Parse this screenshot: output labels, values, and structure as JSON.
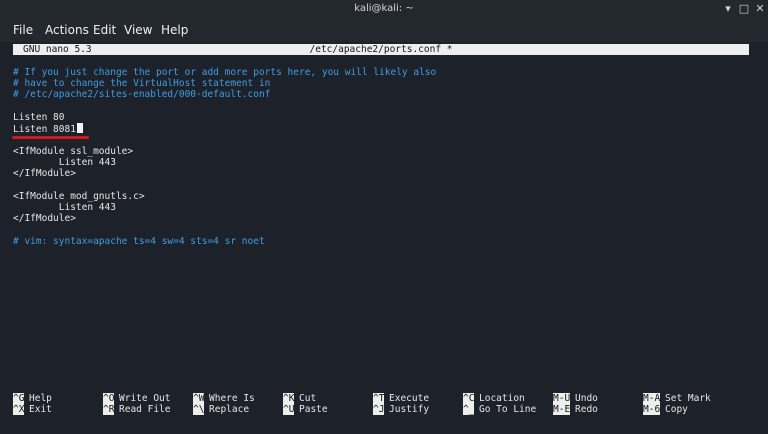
{
  "window": {
    "title": "kali@kali: ~"
  },
  "menu": {
    "file": "File",
    "actions": "Actions",
    "edit": "Edit",
    "view": "View",
    "help": "Help"
  },
  "nano": {
    "version": "GNU nano 5.3",
    "filename": "/etc/apache2/ports.conf *"
  },
  "lines": [
    "# If you just change the port or add more ports here, you will likely also",
    "# have to change the VirtualHost statement in",
    "# /etc/apache2/sites-enabled/000-default.conf",
    "Listen 80",
    "Listen 8081",
    "<IfModule ssl_module>",
    "        Listen 443",
    "</IfModule>",
    "<IfModule mod_gnutls.c>",
    "        Listen 443",
    "</IfModule>",
    "# vim: syntax=apache ts=4 sw=4 sts=4 sr noet"
  ],
  "shortcuts": [
    {
      "key": "^G",
      "label": "Help"
    },
    {
      "key": "^X",
      "label": "Exit"
    },
    {
      "key": "^O",
      "label": "Write Out"
    },
    {
      "key": "^R",
      "label": "Read File"
    },
    {
      "key": "^W",
      "label": "Where Is"
    },
    {
      "key": "^\\",
      "label": "Replace"
    },
    {
      "key": "^K",
      "label": "Cut"
    },
    {
      "key": "^U",
      "label": "Paste"
    },
    {
      "key": "^T",
      "label": "Execute"
    },
    {
      "key": "^J",
      "label": "Justify"
    },
    {
      "key": "^C",
      "label": "Location"
    },
    {
      "key": "^_",
      "label": "Go To Line"
    },
    {
      "key": "M-U",
      "label": "Undo"
    },
    {
      "key": "M-E",
      "label": "Redo"
    },
    {
      "key": "M-A",
      "label": "Set Mark"
    },
    {
      "key": "M-6",
      "label": "Copy"
    }
  ],
  "colors": {
    "comment": "#3f9ce4",
    "highlight": "#cf1a1a",
    "background": "#1d2129"
  }
}
